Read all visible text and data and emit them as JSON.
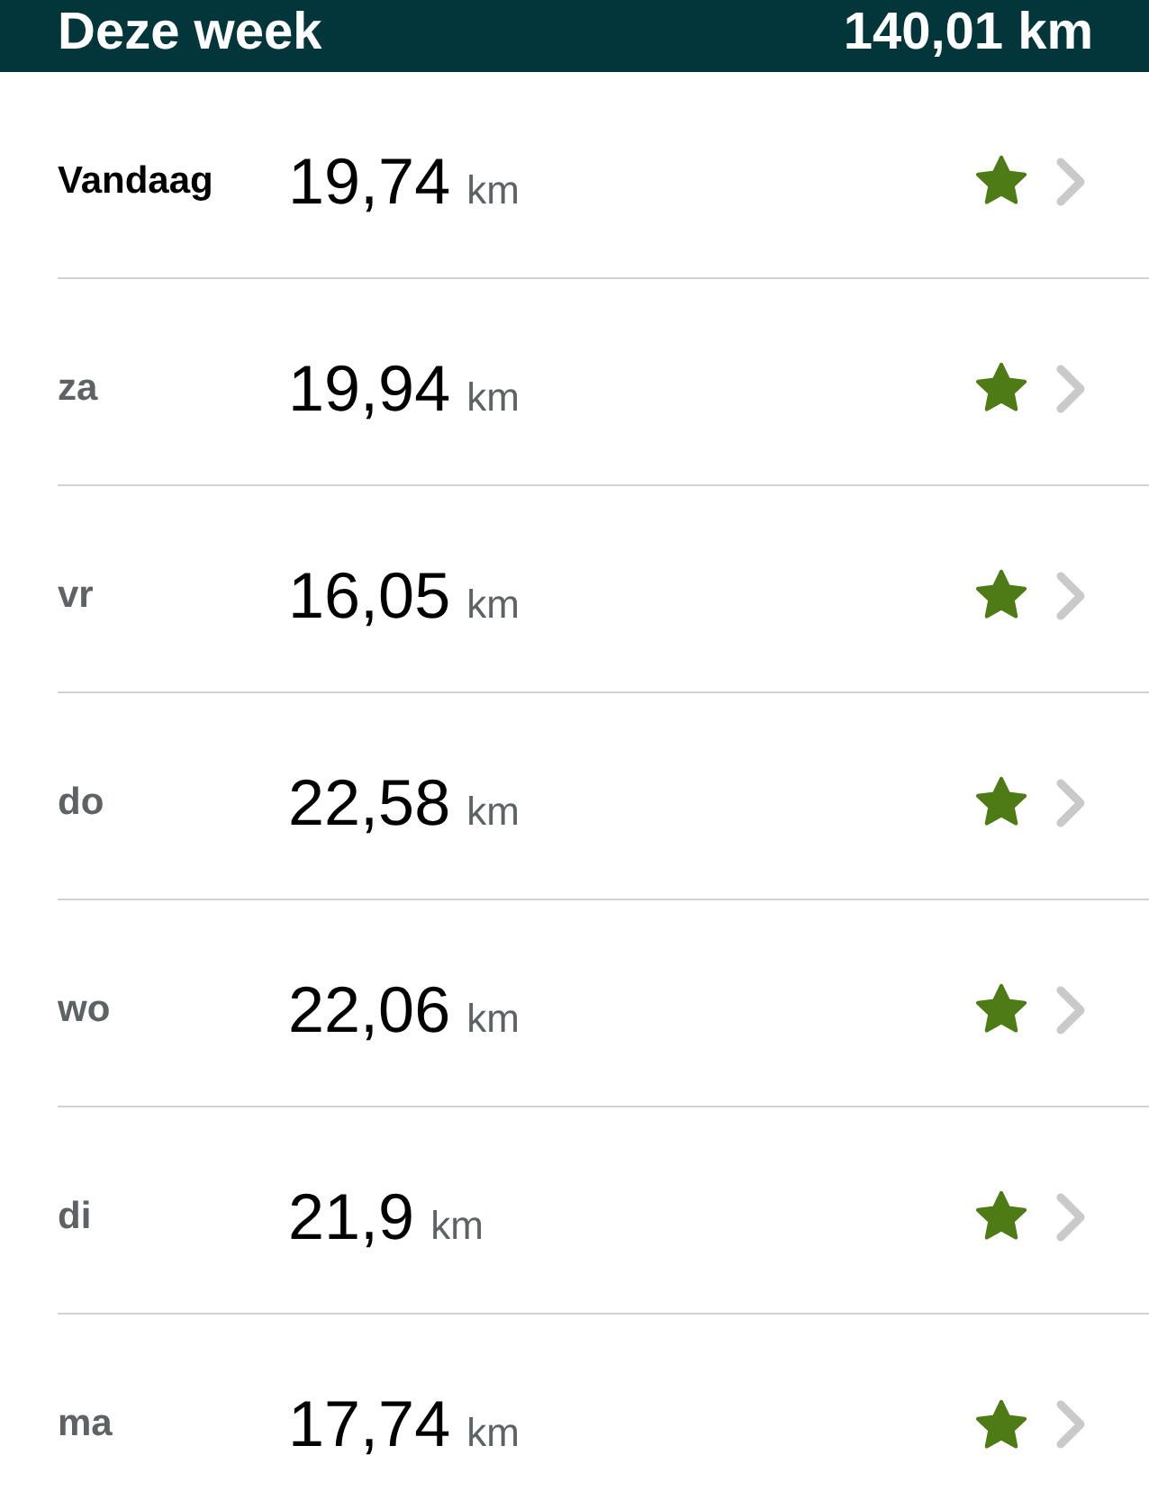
{
  "header": {
    "title": "Deze week",
    "total": "140,01 km"
  },
  "rows": [
    {
      "day": "Vandaag",
      "today": true,
      "distance": "19,74",
      "unit": "km",
      "starred": true
    },
    {
      "day": "za",
      "today": false,
      "distance": "19,94",
      "unit": "km",
      "starred": true
    },
    {
      "day": "vr",
      "today": false,
      "distance": "16,05",
      "unit": "km",
      "starred": true
    },
    {
      "day": "do",
      "today": false,
      "distance": "22,58",
      "unit": "km",
      "starred": true
    },
    {
      "day": "wo",
      "today": false,
      "distance": "22,06",
      "unit": "km",
      "starred": true
    },
    {
      "day": "di",
      "today": false,
      "distance": "21,9",
      "unit": "km",
      "starred": true
    },
    {
      "day": "ma",
      "today": false,
      "distance": "17,74",
      "unit": "km",
      "starred": true
    }
  ]
}
